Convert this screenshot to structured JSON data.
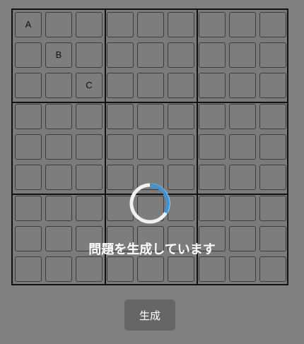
{
  "board": {
    "givens": [
      {
        "row": 0,
        "col": 0,
        "text": "A"
      },
      {
        "row": 1,
        "col": 1,
        "text": "B"
      },
      {
        "row": 2,
        "col": 2,
        "text": "C"
      }
    ]
  },
  "loading": {
    "message": "問題を生成しています"
  },
  "controls": {
    "generate_label": "生成"
  }
}
